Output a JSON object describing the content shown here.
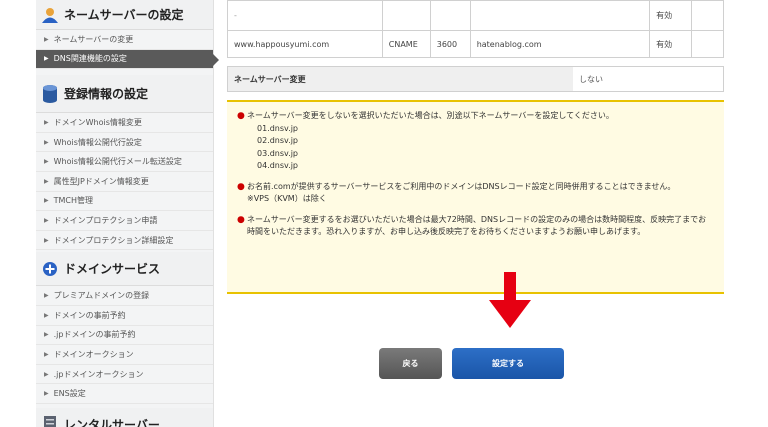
{
  "sidebar": {
    "sections": [
      {
        "title": "ネームサーバーの設定",
        "icon": "nameserver-icon",
        "items": [
          {
            "label": "ネームサーバーの変更",
            "active": false
          },
          {
            "label": "DNS関連機能の設定",
            "active": true
          }
        ]
      },
      {
        "title": "登録情報の設定",
        "icon": "database-icon",
        "items": [
          {
            "label": "ドメインWhois情報変更"
          },
          {
            "label": "Whois情報公開代行設定"
          },
          {
            "label": "Whois情報公開代行メール転送設定"
          },
          {
            "label": "属性型JPドメイン情報変更"
          },
          {
            "label": "TMCH管理"
          },
          {
            "label": "ドメインプロテクション申請"
          },
          {
            "label": "ドメインプロテクション詳細設定"
          }
        ]
      },
      {
        "title": "ドメインサービス",
        "icon": "plus-circle-icon",
        "items": [
          {
            "label": "プレミアムドメインの登録"
          },
          {
            "label": "ドメインの事前予約"
          },
          {
            "label": ".jpドメインの事前予約"
          },
          {
            "label": "ドメインオークション"
          },
          {
            "label": ".jpドメインオークション"
          },
          {
            "label": "ENS設定"
          }
        ]
      },
      {
        "title": "レンタルサーバー",
        "icon": "server-icon",
        "items": []
      }
    ]
  },
  "records": [
    {
      "host": "-",
      "type": "",
      "ttl": "",
      "value": "",
      "status": "有効"
    },
    {
      "host": "www.happousyumi.com",
      "type": "CNAME",
      "ttl": "3600",
      "value": "hatenablog.com",
      "status": "有効"
    }
  ],
  "nameserver_change": {
    "label": "ネームサーバー変更",
    "value": "しない"
  },
  "notice": {
    "item1": "ネームサーバー変更をしないを選択いただいた場合は、別途以下ネームサーバーを設定してください。",
    "dns": [
      "01.dnsv.jp",
      "02.dnsv.jp",
      "03.dnsv.jp",
      "04.dnsv.jp"
    ],
    "item2": "お名前.comが提供するサーバーサービスをご利用中のドメインはDNSレコード設定と同時併用することはできません。",
    "item2_note": "※VPS（KVM）は除く",
    "item3": "ネームサーバー変更するをお選びいただいた場合は最大72時間、DNSレコードの設定のみの場合は数時間程度、反映完了までお時間をいただきます。恐れ入りますが、お申し込み後反映完了をお待ちくださいますようお願い申しあげます。"
  },
  "buttons": {
    "back": "戻る",
    "submit": "設定する"
  },
  "colors": {
    "accent_blue": "#1a55a8",
    "arrow_red": "#e60012",
    "notice_border": "#e8c200"
  }
}
